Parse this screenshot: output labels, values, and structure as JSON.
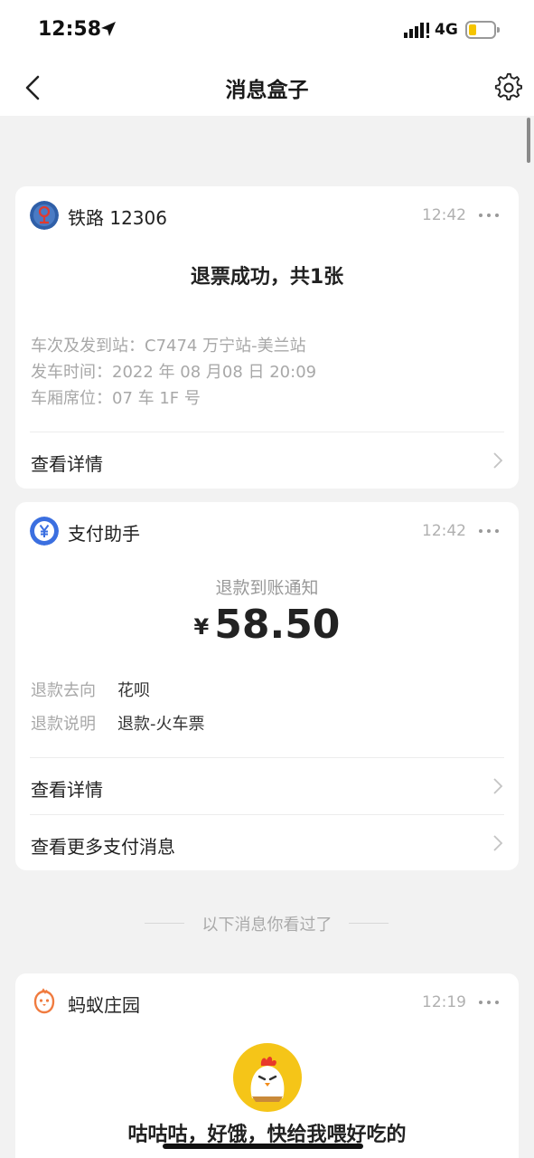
{
  "status_bar": {
    "time": "12:58",
    "network": "4G",
    "location_icon": "location-arrow-icon",
    "battery_color": "#f5c400"
  },
  "nav": {
    "title": "消息盒子",
    "back_icon": "chevron-left-icon",
    "settings_icon": "gear-icon"
  },
  "messages": [
    {
      "source": "铁路 12306",
      "time": "12:42",
      "icon": "railway-logo-icon",
      "title": "退票成功，共1张",
      "details": [
        "车次及发到站：C7474 万宁站-美兰站",
        "发车时间：2022 年 08 月08 日 20:09",
        "车厢席位：07 车 1F 号"
      ],
      "link": "查看详情"
    },
    {
      "source": "支付助手",
      "time": "12:42",
      "icon": "yen-coin-icon",
      "notice": "退款到账通知",
      "currency": "¥",
      "amount": "58.50",
      "fields": [
        {
          "key": "退款去向",
          "value": "花呗"
        },
        {
          "key": "退款说明",
          "value": "退款-火车票"
        }
      ],
      "links": [
        "查看详情",
        "查看更多支付消息"
      ]
    },
    {
      "source": "蚂蚁庄园",
      "time": "12:19",
      "icon": "chick-icon",
      "title": "咕咕咕，好饿，快给我喂好吃的"
    }
  ],
  "seen_separator": "以下消息你看过了",
  "colors": {
    "background": "#f2f2f2",
    "card": "#ffffff",
    "accent_blue": "#3b6fe0",
    "railway_blue": "#2f5fa8"
  }
}
